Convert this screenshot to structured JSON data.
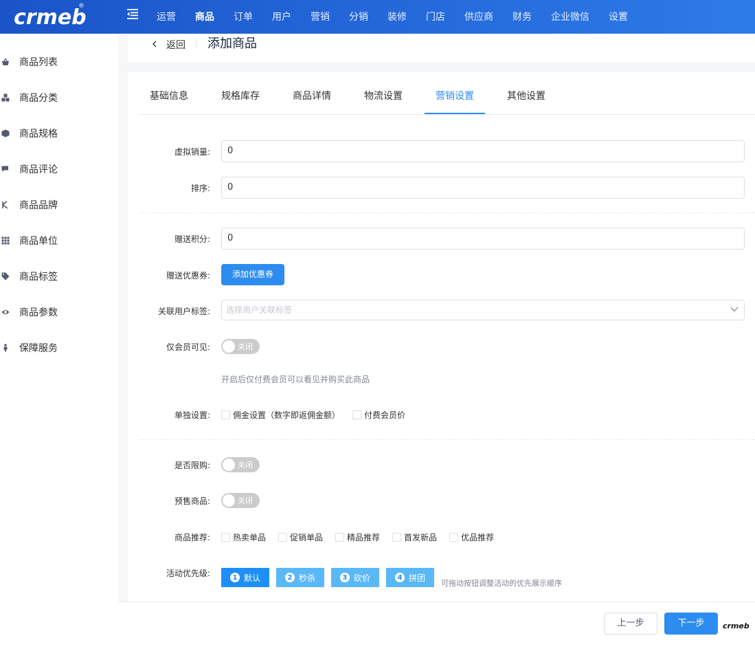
{
  "brand": {
    "logo_text": "crmeb",
    "registered_mark": "®",
    "accent": "#2d8cf0"
  },
  "topnav": [
    {
      "label": "运营"
    },
    {
      "label": "商品"
    },
    {
      "label": "订单"
    },
    {
      "label": "用户"
    },
    {
      "label": "营销"
    },
    {
      "label": "分销"
    },
    {
      "label": "装修"
    },
    {
      "label": "门店"
    },
    {
      "label": "供应商"
    },
    {
      "label": "财务"
    },
    {
      "label": "企业微信"
    },
    {
      "label": "设置"
    }
  ],
  "topnav_active": "商品",
  "sidebar": {
    "items": [
      {
        "label": "商品列表"
      },
      {
        "label": "商品分类"
      },
      {
        "label": "商品规格"
      },
      {
        "label": "商品评论"
      },
      {
        "label": "商品品牌"
      },
      {
        "label": "商品单位"
      },
      {
        "label": "商品标签"
      },
      {
        "label": "商品参数"
      },
      {
        "label": "保障服务"
      }
    ]
  },
  "header": {
    "back_label": "返回",
    "title": "添加商品"
  },
  "tabs": [
    {
      "label": "基础信息"
    },
    {
      "label": "规格库存"
    },
    {
      "label": "商品详情"
    },
    {
      "label": "物流设置"
    },
    {
      "label": "营销设置"
    },
    {
      "label": "其他设置"
    }
  ],
  "tabs_active": "营销设置",
  "form": {
    "virtual_sales": {
      "label": "虚拟销量:",
      "value": "0"
    },
    "sort": {
      "label": "排序:",
      "value": "0"
    },
    "give_points": {
      "label": "赠送积分:",
      "value": "0"
    },
    "give_coupon": {
      "label": "赠送优惠券:",
      "button": "添加优惠券"
    },
    "user_tag": {
      "label": "关联用户标签:",
      "placeholder": "选择用户关联标签"
    },
    "member_only": {
      "label": "仅会员可见:",
      "switch_text": "关闭",
      "hint": "开启后仅付费会员可以看见并购买此商品"
    },
    "separate": {
      "label": "单独设置:",
      "options": [
        {
          "label": "佣金设置（数字即返佣金额）"
        },
        {
          "label": "付费会员价"
        }
      ]
    },
    "limit_buy": {
      "label": "是否限购:",
      "switch_text": "关闭"
    },
    "presale": {
      "label": "预售商品:",
      "switch_text": "关闭"
    },
    "recommend": {
      "label": "商品推荐:",
      "options": [
        {
          "label": "热卖单品"
        },
        {
          "label": "促销单品"
        },
        {
          "label": "精品推荐"
        },
        {
          "label": "首发新品"
        },
        {
          "label": "优品推荐"
        }
      ]
    },
    "priority": {
      "label": "活动优先级:",
      "items": [
        {
          "num": "1",
          "label": "默认"
        },
        {
          "num": "2",
          "label": "秒杀"
        },
        {
          "num": "3",
          "label": "砍价"
        },
        {
          "num": "4",
          "label": "拼团"
        }
      ],
      "hint": "可拖动按钮调整活动的优先展示顺序"
    }
  },
  "footer": {
    "prev_label": "上一步",
    "next_label": "下一步",
    "mini_logo": "crmeb"
  }
}
